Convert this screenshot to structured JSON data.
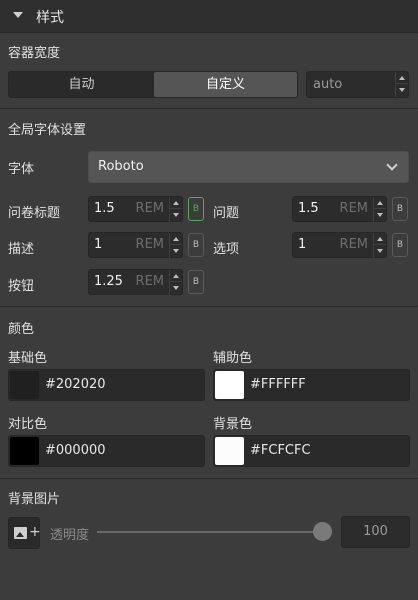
{
  "panel": {
    "title": "样式"
  },
  "container_width": {
    "title": "容器宽度",
    "options": [
      "自动",
      "自定义"
    ],
    "selected": "自定义",
    "value": "auto"
  },
  "global_font": {
    "title": "全局字体设置",
    "font_label": "字体",
    "font_value": "Roboto",
    "unit": "REM",
    "bold_label": "B",
    "rows": [
      {
        "label": "问卷标题",
        "value": "1.5",
        "bold": true
      },
      {
        "label": "问题",
        "value": "1.5",
        "bold": false
      },
      {
        "label": "描述",
        "value": "1",
        "bold": false
      },
      {
        "label": "选项",
        "value": "1",
        "bold": false
      },
      {
        "label": "按钮",
        "value": "1.25",
        "bold": false
      }
    ]
  },
  "colors": {
    "title": "颜色",
    "items": [
      {
        "label": "基础色",
        "hex": "#202020",
        "swatch": "#202020"
      },
      {
        "label": "辅助色",
        "hex": "#FFFFFF",
        "swatch": "#FFFFFF"
      },
      {
        "label": "对比色",
        "hex": "#000000",
        "swatch": "#000000"
      },
      {
        "label": "背景色",
        "hex": "#FCFCFC",
        "swatch": "#FCFCFC"
      }
    ]
  },
  "background_image": {
    "title": "背景图片",
    "opacity_label": "透明度",
    "opacity_value": "100"
  },
  "theme": {
    "accent": "#4caf50",
    "panel_bg": "#3c3c3c"
  }
}
